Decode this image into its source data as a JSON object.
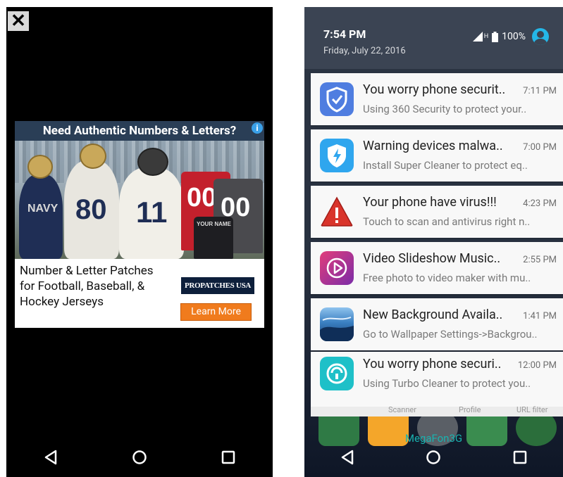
{
  "left": {
    "close_label": "✕",
    "ad": {
      "headline": "Need Authentic Numbers & Letters?",
      "info_icon": "info-icon",
      "description": "Number & Letter Patches for Football, Baseball, & Hockey Jerseys",
      "brand": "PROPATCHES USA",
      "cta": "Learn More",
      "image_texts": {
        "helmet_text": "NAVY",
        "num_1": "80",
        "num_2": "11",
        "num_3": "00",
        "num_4": "00",
        "jersey_name": "YOUR NAME"
      }
    },
    "navbar": {
      "back_icon": "back-triangle-icon",
      "home_icon": "home-circle-icon",
      "recents_icon": "recents-square-icon"
    }
  },
  "right": {
    "status": {
      "time": "7:54 PM",
      "date": "Friday, July 22, 2016",
      "network_label": "H",
      "battery": "100%"
    },
    "notifications": [
      {
        "title": "You worry phone securit..",
        "time": "7:11 PM",
        "body": "Using 360 Security to protect your..",
        "icon": "shield-check-icon",
        "accent": "#4f7de0"
      },
      {
        "title": "Warning devices malwa..",
        "time": "7:00 PM",
        "body": "Install Super Cleaner to protect eq..",
        "icon": "shield-bolt-icon",
        "accent": "#2fa6ee"
      },
      {
        "title": "Your phone have virus!!!",
        "time": "4:23 PM",
        "body": "Touch to scan and antivirus right n..",
        "icon": "warning-triangle-icon",
        "accent": "#d9342b"
      },
      {
        "title": "Video Slideshow Music..",
        "time": "2:55 PM",
        "body": "Free photo to video maker with mu..",
        "icon": "play-circle-icon",
        "accent": "#c2348f"
      },
      {
        "title": "New Background Availa..",
        "time": "1:41 PM",
        "body": "Go to Wallpaper Settings->Backgrou..",
        "icon": "wallpaper-icon",
        "accent": "#3a7fc1"
      },
      {
        "title": "You worry phone securi..",
        "time": "12:00 PM",
        "body": "Using Turbo Cleaner to protect you..",
        "icon": "lock-icon",
        "accent": "#1ec0c8"
      }
    ],
    "peek": {
      "a": "Scanner",
      "b": "Profile",
      "c": "URL filter"
    },
    "carrier": "MegaFon3G",
    "navbar": {
      "back_icon": "back-triangle-icon",
      "home_icon": "home-circle-icon",
      "recents_icon": "recents-square-icon"
    }
  }
}
